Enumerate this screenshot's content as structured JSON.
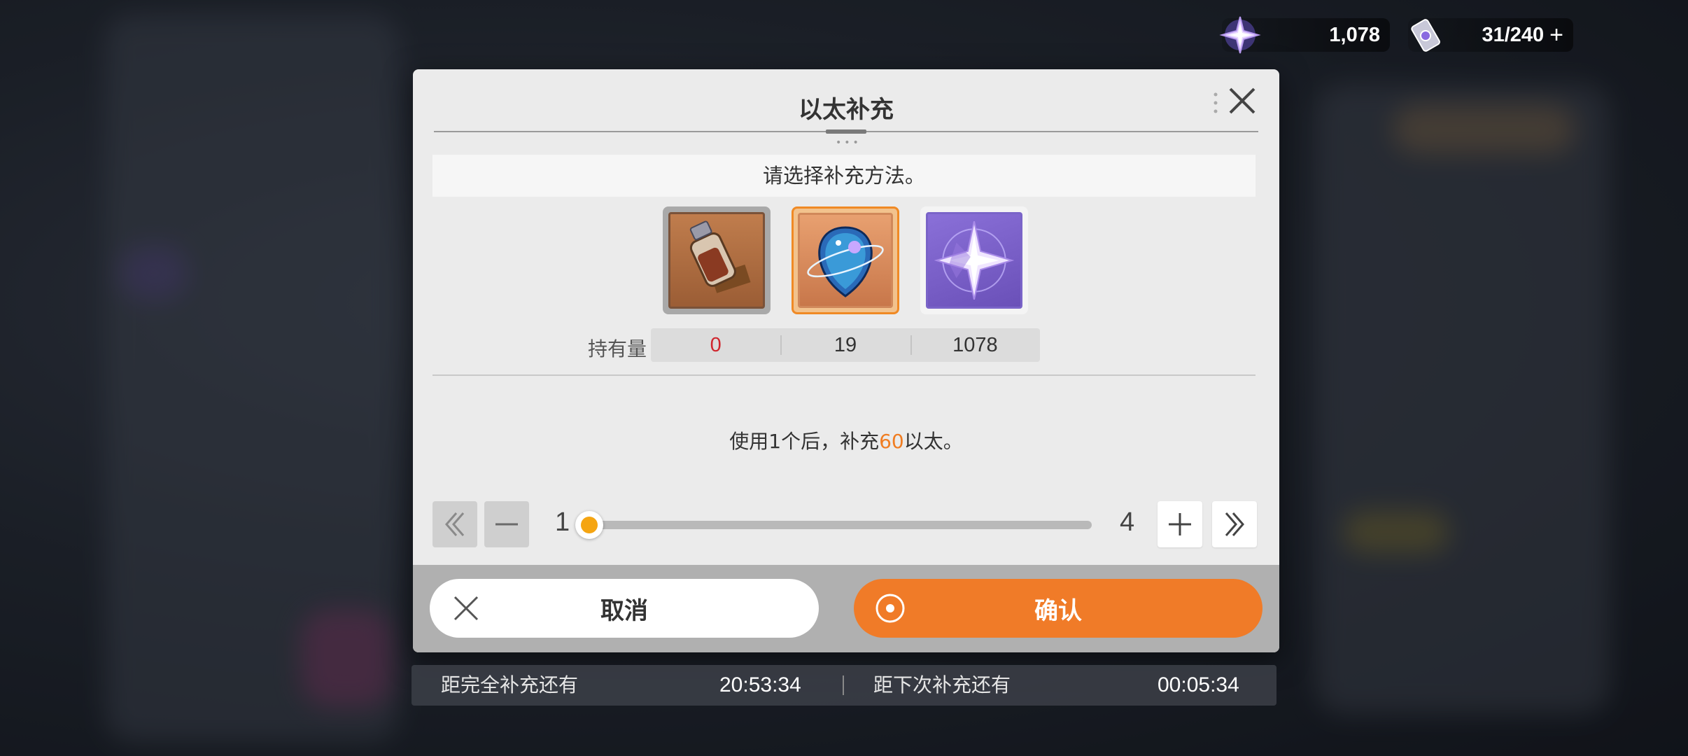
{
  "currency": {
    "crystal_value": "1,078",
    "stamina_value": "31/240",
    "stamina_add": "+"
  },
  "dialog": {
    "title": "以太补充",
    "prompt": "请选择补充方法。",
    "items": [
      {
        "icon": "potion-bottle-icon",
        "count": "0"
      },
      {
        "icon": "ether-orb-icon",
        "count": "19"
      },
      {
        "icon": "star-crystal-icon",
        "count": "1078"
      }
    ],
    "selected_index": 1,
    "hold_label": "持有量",
    "desc_prefix": "使用1个后，补充",
    "desc_amount": "60",
    "desc_suffix": "以太。",
    "quantity": {
      "current": "1",
      "max": "4",
      "value": 1,
      "min": 1,
      "max_value": 4
    },
    "cancel_label": "取消",
    "confirm_label": "确认"
  },
  "timer": {
    "full_label": "距完全补充还有",
    "full_value": "20:53:34",
    "next_label": "距下次补充还有",
    "next_value": "00:05:34"
  },
  "colors": {
    "accent": "#f07b28",
    "zero_count": "#d0262e"
  }
}
